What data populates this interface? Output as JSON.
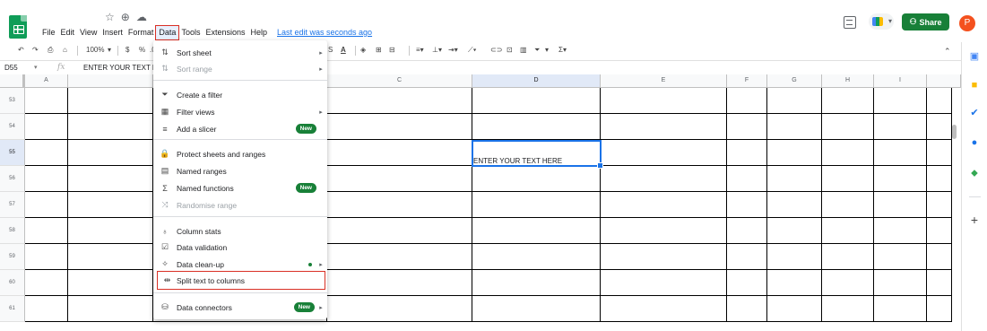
{
  "title_bar": {
    "icons": [
      "☆",
      "⊕",
      "☁"
    ],
    "menu": [
      "File",
      "Edit",
      "View",
      "Insert",
      "Format",
      "Data",
      "Tools",
      "Extensions",
      "Help"
    ],
    "active_menu": "Data",
    "last_edit": "Last edit was seconds ago",
    "share_label": "Share",
    "avatar_letter": "P"
  },
  "toolbar": {
    "zoom": "100%",
    "currency": "$",
    "percent": "%",
    "decimal": ".0",
    "bold": "B",
    "italic": "I",
    "strike": "S",
    "text_color": "A"
  },
  "formula_bar": {
    "cell_ref": "D55",
    "fx": "fx",
    "value": "ENTER YOUR TEXT HERE"
  },
  "grid": {
    "columns": [
      "A",
      "",
      "C",
      "D",
      "E",
      "F",
      "G",
      "H",
      "I"
    ],
    "selected_column": "D",
    "rows": [
      "53",
      "54",
      "55",
      "56",
      "57",
      "58",
      "59",
      "60",
      "61"
    ],
    "selected_row": "55",
    "active_cell_text": "ENTER YOUR TEXT HERE"
  },
  "data_menu": {
    "items": [
      {
        "label": "Sort sheet",
        "icon": "sort-icon",
        "glyph": "⇅",
        "arrow": "▸",
        "disabled": false
      },
      {
        "label": "Sort range",
        "icon": "sort-range-icon",
        "glyph": "⇅",
        "arrow": "▸",
        "disabled": true
      },
      {
        "label": "Create a filter",
        "icon": "filter-icon",
        "glyph": "⏷",
        "disabled": false
      },
      {
        "label": "Filter views",
        "icon": "filter-views-icon",
        "glyph": "▦",
        "arrow": "▸",
        "disabled": false
      },
      {
        "label": "Add a slicer",
        "icon": "slicer-icon",
        "glyph": "≡",
        "badge": "New",
        "disabled": false
      },
      {
        "label": "Protect sheets and ranges",
        "icon": "lock-icon",
        "glyph": "🔒",
        "disabled": false
      },
      {
        "label": "Named ranges",
        "icon": "named-ranges-icon",
        "glyph": "▤",
        "disabled": false
      },
      {
        "label": "Named functions",
        "icon": "sigma-icon",
        "glyph": "Σ",
        "badge": "New",
        "disabled": false
      },
      {
        "label": "Randomise range",
        "icon": "shuffle-icon",
        "glyph": "⤨",
        "disabled": true
      },
      {
        "label": "Column stats",
        "icon": "lightbulb-icon",
        "glyph": "♁",
        "disabled": false
      },
      {
        "label": "Data validation",
        "icon": "validation-icon",
        "glyph": "☑",
        "disabled": false
      },
      {
        "label": "Data clean-up",
        "icon": "cleanup-icon",
        "glyph": "✧",
        "arrow": "▸",
        "dot": true,
        "disabled": false
      },
      {
        "label": "Split text to columns",
        "icon": "split-icon",
        "glyph": "⇹",
        "disabled": false,
        "highlight": true
      },
      {
        "label": "Data connectors",
        "icon": "database-icon",
        "glyph": "⛁",
        "badge": "New",
        "arrow": "▸",
        "disabled": false
      }
    ]
  },
  "colors": {
    "share_green": "#188038",
    "highlight_red": "#d93025",
    "select_blue": "#1a73e8",
    "avatar_orange": "#f4511e"
  }
}
